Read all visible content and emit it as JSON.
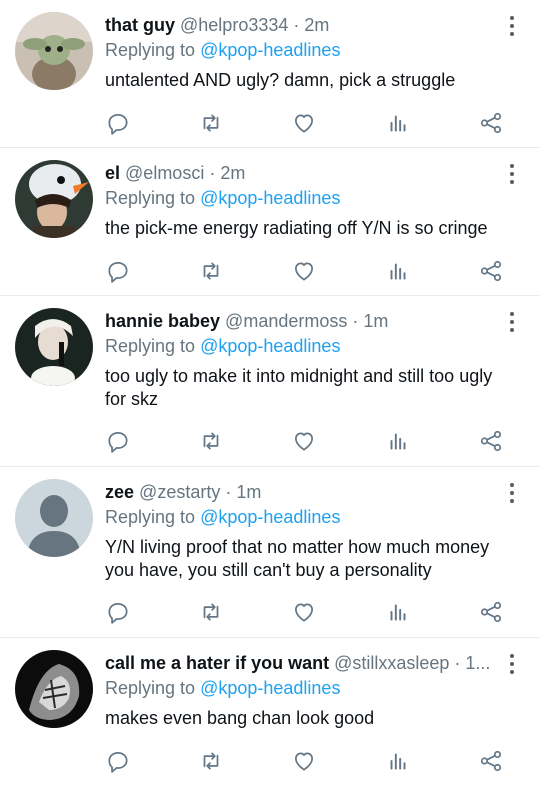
{
  "tweets": [
    {
      "name": "that guy",
      "handle": "@helpro3334",
      "time": "· 2m",
      "replying_prefix": "Replying to",
      "replying_to": "@kpop-headlines",
      "text": "untalented AND ugly? damn, pick a struggle"
    },
    {
      "name": "el",
      "handle": "@elmosci",
      "time": "· 2m",
      "replying_prefix": "Replying to",
      "replying_to": "@kpop-headlines",
      "text": "the pick-me energy radiating off Y/N is so cringe"
    },
    {
      "name": "hannie babey",
      "handle": "@mandermoss",
      "time": "· 1m",
      "replying_prefix": "Replying to",
      "replying_to": "@kpop-headlines",
      "text": "too ugly to make it into midnight and still too ugly for skz"
    },
    {
      "name": "zee",
      "handle": "@zestarty",
      "time": "· 1m",
      "replying_prefix": "Replying to",
      "replying_to": "@kpop-headlines",
      "text": "Y/N living proof that no matter how much money you have, you still can't buy a personality"
    },
    {
      "name": "call me a hater if you want",
      "handle": "@stillxxasleep",
      "time": "· 1...",
      "replying_prefix": "Replying to",
      "replying_to": "@kpop-headlines",
      "text": "makes even bang chan look good"
    }
  ],
  "icons": {
    "reply": "reply-icon",
    "retweet": "retweet-icon",
    "like": "heart-icon",
    "analytics": "analytics-icon",
    "share": "share-icon",
    "more": "more-vertical-icon"
  },
  "colors": {
    "link": "#1da1f2",
    "muted": "#66757f",
    "icon": "#657786",
    "divider": "#e6ecf0"
  }
}
